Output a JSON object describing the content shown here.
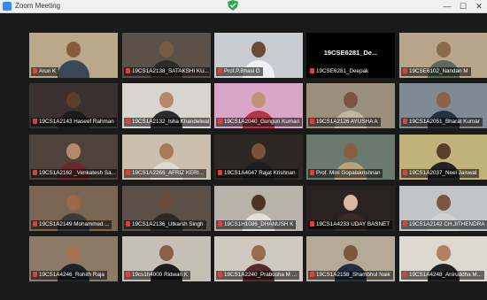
{
  "window": {
    "title": "Zoom Meeting",
    "minimize": "—",
    "maximize": "☐",
    "close": "✕"
  },
  "participants": [
    {
      "name": "Arun K",
      "bg": "#b9a98a",
      "skin": "#8a5a3c",
      "shirt": "#3b4656"
    },
    {
      "name": "19CS1A2138_SATAKSHI KU...",
      "bg": "#5c5148",
      "skin": "#7a5a42",
      "shirt": "#2e2a28"
    },
    {
      "name": "Prof.P.Bhasi G",
      "bg": "#c9ccd0",
      "skin": "#6a4a32",
      "shirt": "#eef0f2"
    },
    {
      "name": "19CSE6281_Deepak",
      "bg": "#000000",
      "no_video": true,
      "display": "19CSE6281_De..."
    },
    {
      "name": "19CSE6102_Nandan M",
      "bg": "#b8a58a",
      "skin": "#8b6a4e",
      "shirt": "#5c6a5a"
    },
    {
      "name": "19CS1A2143 Haseef Rahman",
      "bg": "#3a3030",
      "skin": "#5a3e2c",
      "shirt": "#1c1c1c"
    },
    {
      "name": "19CS1A2132_Isha Khandelwal",
      "bg": "#d8d5cf",
      "skin": "#b58868",
      "shirt": "#2b2b2b"
    },
    {
      "name": "19CS1A2040_Gungun Kumari",
      "bg": "#d9a6c8",
      "skin": "#c09278",
      "shirt": "#b3364a"
    },
    {
      "name": "19CS1A2126 AYUSHA A",
      "bg": "#9a8f7c",
      "skin": "#7a5440",
      "shirt": "#c2b5a5"
    },
    {
      "name": "19CS1A2051_Bharat Kumar",
      "bg": "#7f8a92",
      "skin": "#8a6248",
      "shirt": "#26313f"
    },
    {
      "name": "19CS1A2162 _Venkatesh Sa...",
      "bg": "#4e433a",
      "skin": "#b58a6a",
      "shirt": "#6a2a2a"
    },
    {
      "name": "19CS1A2266_AFRIZ KERI...",
      "bg": "#cbbfae",
      "skin": "#a87a5a",
      "shirt": "#e0dad0"
    },
    {
      "name": "19CS1A4047 Rajat Krishnan",
      "bg": "#2e2824",
      "skin": "#7a5238",
      "shirt": "#1e1e22"
    },
    {
      "name": "Prof. Mini Gopalakrishnan",
      "bg": "#6b7a6e",
      "skin": "#8a5e40",
      "shirt": "#b7a27a"
    },
    {
      "name": "19CS1A2037_Neel Jaiswal",
      "bg": "#c0b27a",
      "skin": "#5a3e2c",
      "shirt": "#232323"
    },
    {
      "name": "19CS1A2149 Mohammed ...",
      "bg": "#7a6452",
      "skin": "#9a6a48",
      "shirt": "#3c3a3a"
    },
    {
      "name": "19CS1A2136_Utkarsh Singh",
      "bg": "#5a5048",
      "skin": "#6a4a36",
      "shirt": "#2a2a2a"
    },
    {
      "name": "19CS1H1086_DHANUSH K",
      "bg": "#b7b2aa",
      "skin": "#4e3424",
      "shirt": "#e2e0dc"
    },
    {
      "name": "19CS1A4233 UDAY BASNET",
      "bg": "#2a2220",
      "skin": "#d7b9a0",
      "shirt": "#3a2a24"
    },
    {
      "name": "19CS1A2142 CH.JITHENDRA",
      "bg": "#c2c5c8",
      "skin": "#7a5640",
      "shirt": "#d0d0d0"
    },
    {
      "name": "19CS1A4246_Rohith Raja",
      "bg": "#8d7a66",
      "skin": "#a47252",
      "shirt": "#1e2228"
    },
    {
      "name": "19cs1h4000 Ridwan K",
      "bg": "#c5bfb5",
      "skin": "#8a6046",
      "shirt": "#1c1c1c"
    },
    {
      "name": "19CS1A2240_Prabusha M ...",
      "bg": "#cfc9bf",
      "skin": "#9a6a4e",
      "shirt": "#5a2a2a"
    },
    {
      "name": "19CS1A2158_Shambhul Naik",
      "bg": "#b5aa98",
      "skin": "#7a5840",
      "shirt": "#203040"
    },
    {
      "name": "19CS1A4248_Aniruddha M...",
      "bg": "#ddd8d0",
      "skin": "#b08062",
      "shirt": "#222222"
    }
  ]
}
